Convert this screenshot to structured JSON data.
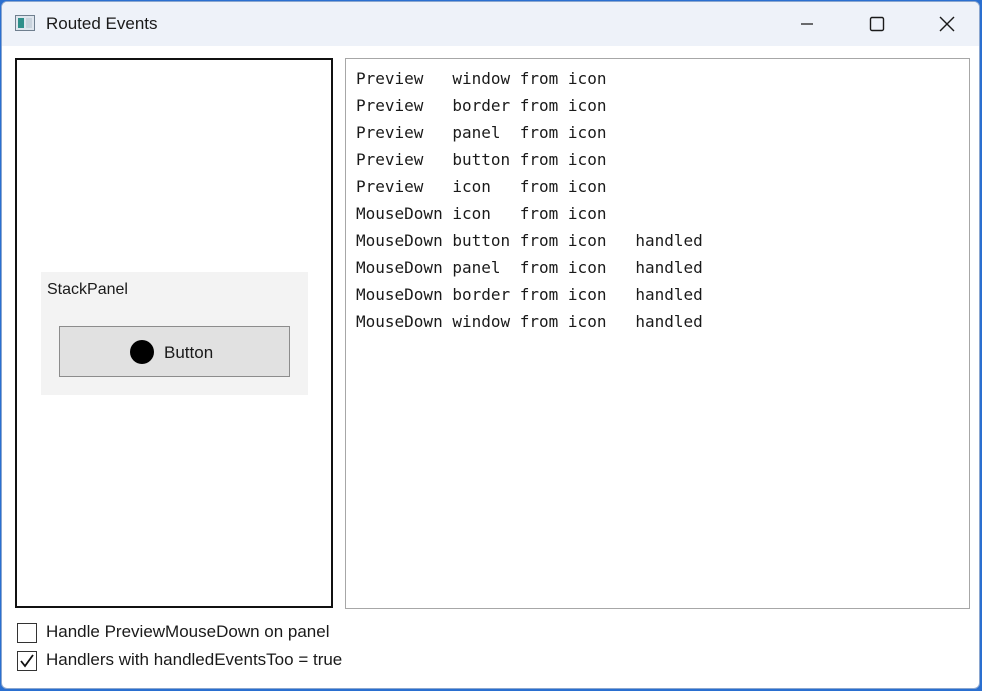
{
  "window": {
    "title": "Routed Events",
    "icons": {
      "app": "app-window-icon",
      "minimize": "minimize-icon",
      "maximize": "maximize-icon",
      "close": "close-icon"
    }
  },
  "demo": {
    "stackpanel_label": "StackPanel",
    "button_label": "Button",
    "button_icon": "filled-circle-icon"
  },
  "log": {
    "lines": [
      "Preview   window from icon",
      "Preview   border from icon",
      "Preview   panel  from icon",
      "Preview   button from icon",
      "Preview   icon   from icon",
      "MouseDown icon   from icon",
      "MouseDown button from icon   handled",
      "MouseDown panel  from icon   handled",
      "MouseDown border from icon   handled",
      "MouseDown window from icon   handled"
    ]
  },
  "options": [
    {
      "label": "Handle PreviewMouseDown on panel",
      "checked": false
    },
    {
      "label": "Handlers with handledEventsToo = true",
      "checked": true
    }
  ],
  "colors": {
    "stackpanel_bg": "#f3f3f3",
    "button_bg": "#e1e1e1",
    "titlebar_bg": "#eef2f9"
  }
}
